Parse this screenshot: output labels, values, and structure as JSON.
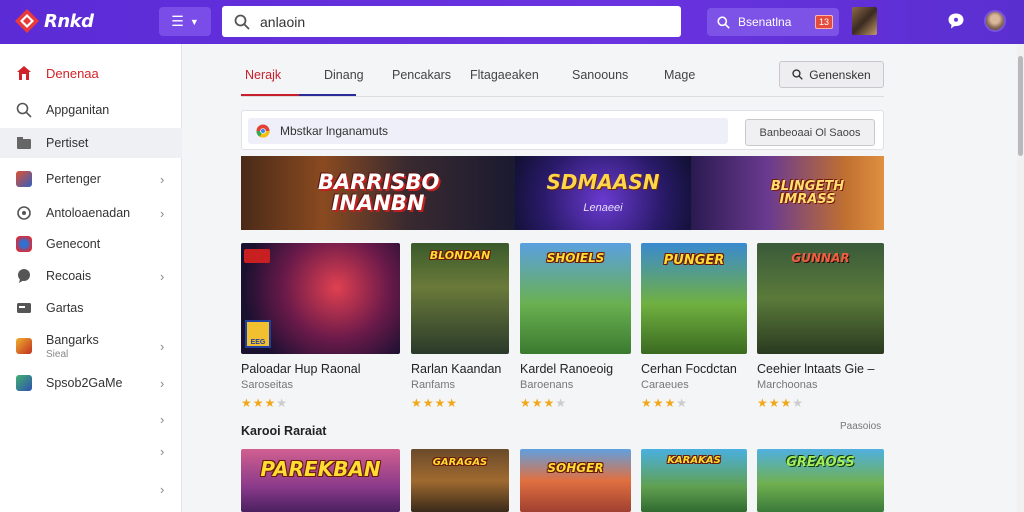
{
  "app": {
    "logo_text": "Rnkd"
  },
  "header": {
    "search_value": "anlaoin",
    "search_button_label": "Bsenatlna",
    "search_button_tag": "13"
  },
  "sidebar": {
    "items": [
      {
        "label": "Denenaa"
      },
      {
        "label": "Appganitan"
      },
      {
        "label": "Pertiset"
      },
      {
        "label": "Pertenger"
      },
      {
        "label": "Antoloaenadan"
      },
      {
        "label": "Genecont"
      },
      {
        "label": "Recoais"
      },
      {
        "label": "Gartas"
      },
      {
        "label": "Bangarks",
        "sub": "Sieal"
      },
      {
        "label": "Spsob2GaMe"
      }
    ]
  },
  "tabs": [
    "Nerajk",
    "Dinang",
    "Pencakars",
    "Fltagaeaken",
    "Sanoouns",
    "Mage"
  ],
  "generate_button": "Genensken",
  "notice": {
    "text": "Mbstkar lnganamuts",
    "button": "Banbeoaai Ol Saoos"
  },
  "banner": {
    "panels": [
      {
        "title": "BARRISBO INANBN"
      },
      {
        "title": "SDMAASN",
        "subtitle": "Lenaeei"
      },
      {
        "title": "BLINGETH IMRASS"
      }
    ]
  },
  "games": [
    {
      "name": "Paloadar Hup Raonal",
      "sub": "Saroseitas",
      "rating": 3,
      "badge": "EEG"
    },
    {
      "name": "Rarlan Kaandan",
      "sub": "Ranfams",
      "rating": 4,
      "title": "BLONDAN"
    },
    {
      "name": "Kardel Ranoeoig",
      "sub": "Baroenans",
      "rating": 3,
      "title": "SHOIELS"
    },
    {
      "name": "Cerhan Focdctan",
      "sub": "Caraeues",
      "rating": 3,
      "title": "PUNGER"
    },
    {
      "name": "Ceehier lntaats Gie –",
      "sub": "Marchoonas",
      "rating": 3,
      "title": "GUNNAR"
    }
  ],
  "section": {
    "title": "Karooi Raraiat",
    "more": "Paasoios"
  },
  "row2_titles": [
    "PAREKBAN",
    "GARAGAS",
    "SOHGER",
    "KARAKAS",
    "GREAOSS"
  ]
}
